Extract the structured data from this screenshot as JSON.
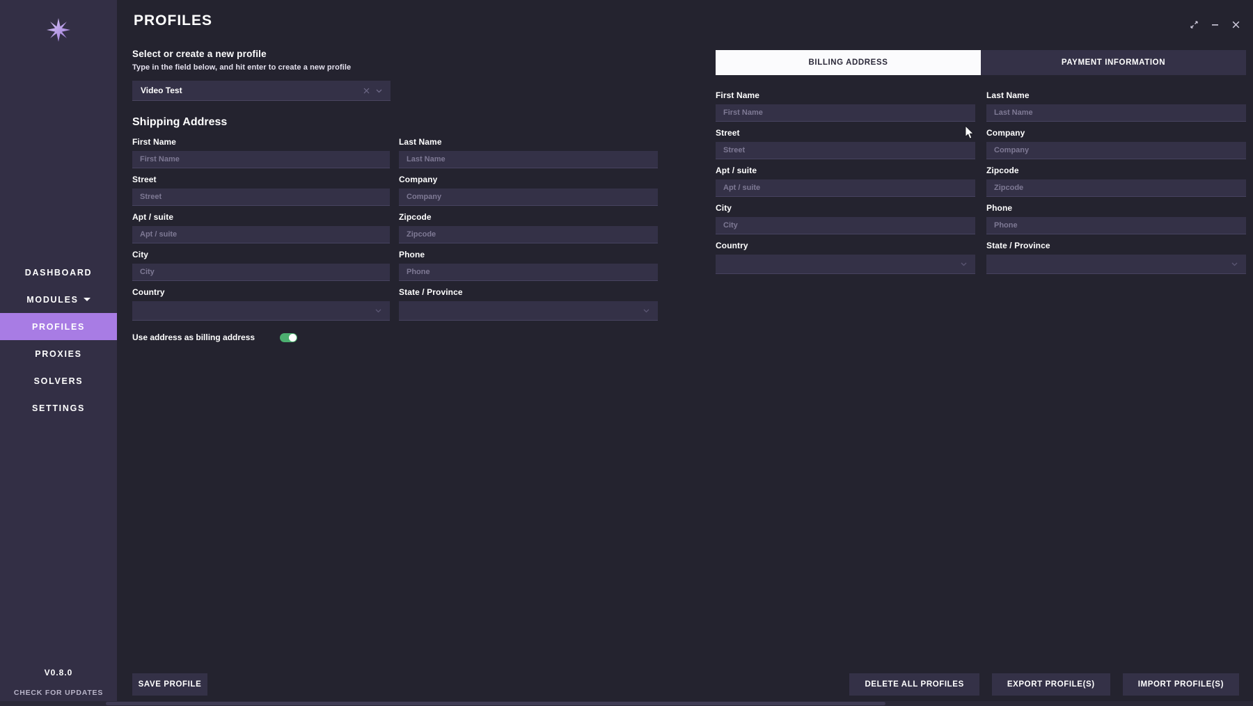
{
  "app": {
    "title": "PROFILES",
    "version": "V0.8.0",
    "check_updates": "CHECK FOR UPDATES",
    "accent_color": "#a87ce4",
    "sidebar_bg": "#332f45",
    "content_bg": "#24232f",
    "input_bg": "#343147",
    "toggle_on_color": "#4caf70"
  },
  "window_controls": [
    {
      "name": "expand-icon",
      "label": "Expand"
    },
    {
      "name": "minimize-icon",
      "label": "Minimize"
    },
    {
      "name": "close-icon",
      "label": "Close"
    }
  ],
  "sidebar": {
    "logo_icon": "eight-point-star-icon",
    "items": [
      {
        "label": "DASHBOARD",
        "active": false,
        "has_caret": false
      },
      {
        "label": "MODULES",
        "active": false,
        "has_caret": true
      },
      {
        "label": "PROFILES",
        "active": true,
        "has_caret": false
      },
      {
        "label": "PROXIES",
        "active": false,
        "has_caret": false
      },
      {
        "label": "SOLVERS",
        "active": false,
        "has_caret": false
      },
      {
        "label": "SETTINGS",
        "active": false,
        "has_caret": false
      }
    ]
  },
  "profile_selector": {
    "heading": "Select or create a new profile",
    "subheading": "Type in the field below, and hit enter to create a new profile",
    "value": "Video Test",
    "clear_icon": "close-icon",
    "dropdown_icon": "chevron-down-icon"
  },
  "shipping": {
    "title": "Shipping Address",
    "fields": [
      {
        "label": "First Name",
        "placeholder": "First Name",
        "value": "",
        "type": "text"
      },
      {
        "label": "Last Name",
        "placeholder": "Last Name",
        "value": "",
        "type": "text"
      },
      {
        "label": "Street",
        "placeholder": "Street",
        "value": "",
        "type": "text"
      },
      {
        "label": "Company",
        "placeholder": "Company",
        "value": "",
        "type": "text"
      },
      {
        "label": "Apt / suite",
        "placeholder": "Apt / suite",
        "value": "",
        "type": "text"
      },
      {
        "label": "Zipcode",
        "placeholder": "Zipcode",
        "value": "",
        "type": "text"
      },
      {
        "label": "City",
        "placeholder": "City",
        "value": "",
        "type": "text"
      },
      {
        "label": "Phone",
        "placeholder": "Phone",
        "value": "",
        "type": "text"
      },
      {
        "label": "Country",
        "placeholder": "",
        "value": "",
        "type": "select"
      },
      {
        "label": "State / Province",
        "placeholder": "",
        "value": "",
        "type": "select"
      }
    ],
    "billing_toggle": {
      "label": "Use address as billing address",
      "enabled": true
    }
  },
  "right_panel": {
    "tabs": [
      {
        "label": "BILLING ADDRESS",
        "active": true
      },
      {
        "label": "PAYMENT INFORMATION",
        "active": false
      }
    ],
    "fields": [
      {
        "label": "First Name",
        "placeholder": "First Name",
        "value": "",
        "type": "text"
      },
      {
        "label": "Last Name",
        "placeholder": "Last Name",
        "value": "",
        "type": "text"
      },
      {
        "label": "Street",
        "placeholder": "Street",
        "value": "",
        "type": "text"
      },
      {
        "label": "Company",
        "placeholder": "Company",
        "value": "",
        "type": "text"
      },
      {
        "label": "Apt / suite",
        "placeholder": "Apt / suite",
        "value": "",
        "type": "text"
      },
      {
        "label": "Zipcode",
        "placeholder": "Zipcode",
        "value": "",
        "type": "text"
      },
      {
        "label": "City",
        "placeholder": "City",
        "value": "",
        "type": "text"
      },
      {
        "label": "Phone",
        "placeholder": "Phone",
        "value": "",
        "type": "text"
      },
      {
        "label": "Country",
        "placeholder": "",
        "value": "",
        "type": "select"
      },
      {
        "label": "State / Province",
        "placeholder": "",
        "value": "",
        "type": "select"
      }
    ]
  },
  "actions": {
    "save": "SAVE PROFILE",
    "delete_all": "DELETE ALL PROFILES",
    "export": "EXPORT PROFILE(S)",
    "import": "IMPORT PROFILE(S)"
  }
}
